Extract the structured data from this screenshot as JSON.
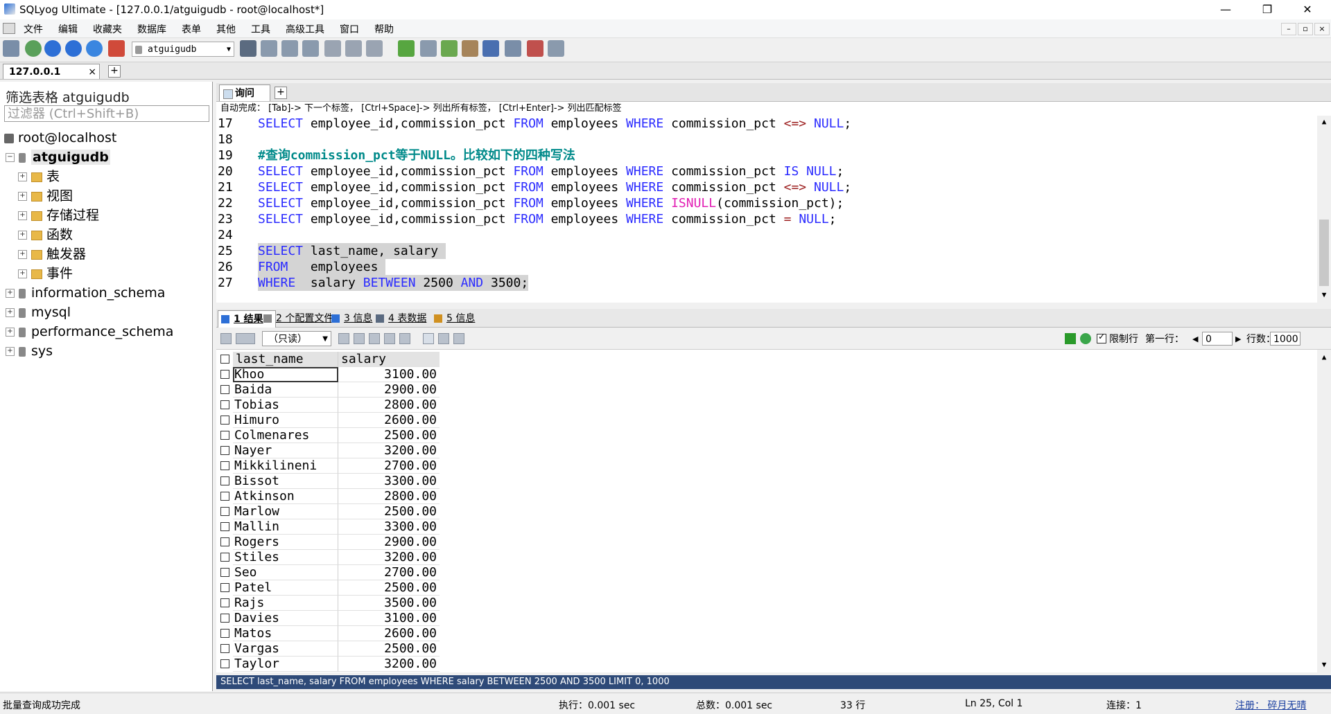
{
  "window": {
    "title": "SQLyog Ultimate - [127.0.0.1/atguigudb - root@localhost*]",
    "minimize": "—",
    "maximize": "❐",
    "close": "✕"
  },
  "menu": [
    "文件",
    "编辑",
    "收藏夹",
    "数据库",
    "表单",
    "其他",
    "工具",
    "高级工具",
    "窗口",
    "帮助"
  ],
  "toolbar": {
    "database_select": "atguigudb"
  },
  "connection_tab": {
    "label": "127.0.0.1",
    "close": "×"
  },
  "left_panel": {
    "filter_label": "筛选表格 atguigudb",
    "filter_placeholder": "过滤器 (Ctrl+Shift+B)",
    "server": "root@localhost",
    "current_db": "atguigudb",
    "current_db_children": [
      "表",
      "视图",
      "存储过程",
      "函数",
      "触发器",
      "事件"
    ],
    "other_dbs": [
      "information_schema",
      "mysql",
      "performance_schema",
      "sys"
    ]
  },
  "editor": {
    "tab_label": "询问",
    "autocomplete_hint": "自动完成： [Tab]-> 下一个标签， [Ctrl+Space]-> 列出所有标签， [Ctrl+Enter]-> 列出匹配标签",
    "lines": [
      {
        "n": "17",
        "parts": [
          [
            "kw",
            "SELECT"
          ],
          [
            "t",
            " employee_id,commission_pct "
          ],
          [
            "kw",
            "FROM"
          ],
          [
            "t",
            " employees "
          ],
          [
            "kw",
            "WHERE"
          ],
          [
            "t",
            " commission_pct "
          ],
          [
            "op",
            "<=>"
          ],
          [
            "t",
            " "
          ],
          [
            "kw",
            "NULL"
          ],
          [
            "t",
            ";"
          ]
        ]
      },
      {
        "n": "18",
        "parts": []
      },
      {
        "n": "19",
        "parts": [
          [
            "cm",
            "#查询commission_pct等于NULL。比较如下的四种写法"
          ]
        ]
      },
      {
        "n": "20",
        "parts": [
          [
            "kw",
            "SELECT"
          ],
          [
            "t",
            " employee_id,commission_pct "
          ],
          [
            "kw",
            "FROM"
          ],
          [
            "t",
            " employees "
          ],
          [
            "kw",
            "WHERE"
          ],
          [
            "t",
            " commission_pct "
          ],
          [
            "kw",
            "IS NULL"
          ],
          [
            "t",
            ";"
          ]
        ]
      },
      {
        "n": "21",
        "parts": [
          [
            "kw",
            "SELECT"
          ],
          [
            "t",
            " employee_id,commission_pct "
          ],
          [
            "kw",
            "FROM"
          ],
          [
            "t",
            " employees "
          ],
          [
            "kw",
            "WHERE"
          ],
          [
            "t",
            " commission_pct "
          ],
          [
            "op",
            "<=>"
          ],
          [
            "t",
            " "
          ],
          [
            "kw",
            "NULL"
          ],
          [
            "t",
            ";"
          ]
        ]
      },
      {
        "n": "22",
        "parts": [
          [
            "kw",
            "SELECT"
          ],
          [
            "t",
            " employee_id,commission_pct "
          ],
          [
            "kw",
            "FROM"
          ],
          [
            "t",
            " employees "
          ],
          [
            "kw",
            "WHERE"
          ],
          [
            "t",
            " "
          ],
          [
            "fn",
            "ISNULL"
          ],
          [
            "t",
            "(commission_pct);"
          ]
        ]
      },
      {
        "n": "23",
        "parts": [
          [
            "kw",
            "SELECT"
          ],
          [
            "t",
            " employee_id,commission_pct "
          ],
          [
            "kw",
            "FROM"
          ],
          [
            "t",
            " employees "
          ],
          [
            "kw",
            "WHERE"
          ],
          [
            "t",
            " commission_pct "
          ],
          [
            "op",
            "="
          ],
          [
            "t",
            " "
          ],
          [
            "kw",
            "NULL"
          ],
          [
            "t",
            ";"
          ]
        ]
      },
      {
        "n": "24",
        "parts": []
      },
      {
        "n": "25",
        "sel": true,
        "parts": [
          [
            "kw",
            "SELECT"
          ],
          [
            "t",
            " last_name, salary "
          ]
        ]
      },
      {
        "n": "26",
        "sel": true,
        "parts": [
          [
            "kw",
            "FROM"
          ],
          [
            "t",
            "   employees "
          ]
        ]
      },
      {
        "n": "27",
        "sel": true,
        "parts": [
          [
            "kw",
            "WHERE"
          ],
          [
            "t",
            "  salary "
          ],
          [
            "kw",
            "BETWEEN"
          ],
          [
            "t",
            " 2500 "
          ],
          [
            "kw",
            "AND"
          ],
          [
            "t",
            " 3500;"
          ]
        ]
      }
    ]
  },
  "result_tabs": [
    {
      "label": "1 结果",
      "active": true
    },
    {
      "label": "2 个配置文件",
      "active": false
    },
    {
      "label": "3 信息",
      "active": false
    },
    {
      "label": "4 表数据",
      "active": false
    },
    {
      "label": "5 信息",
      "active": false
    }
  ],
  "result_toolbar": {
    "mode_select": "（只读）",
    "limit_label": "限制行",
    "first_row_label": "第一行：",
    "first_row_value": "0",
    "rows_label": "行数：",
    "rows_value": "1000"
  },
  "grid": {
    "columns": [
      "last_name",
      "salary"
    ],
    "rows": [
      [
        "Khoo",
        "3100.00"
      ],
      [
        "Baida",
        "2900.00"
      ],
      [
        "Tobias",
        "2800.00"
      ],
      [
        "Himuro",
        "2600.00"
      ],
      [
        "Colmenares",
        "2500.00"
      ],
      [
        "Nayer",
        "3200.00"
      ],
      [
        "Mikkilineni",
        "2700.00"
      ],
      [
        "Bissot",
        "3300.00"
      ],
      [
        "Atkinson",
        "2800.00"
      ],
      [
        "Marlow",
        "2500.00"
      ],
      [
        "Mallin",
        "3300.00"
      ],
      [
        "Rogers",
        "2900.00"
      ],
      [
        "Stiles",
        "3200.00"
      ],
      [
        "Seo",
        "2700.00"
      ],
      [
        "Patel",
        "2500.00"
      ],
      [
        "Rajs",
        "3500.00"
      ],
      [
        "Davies",
        "3100.00"
      ],
      [
        "Matos",
        "2600.00"
      ],
      [
        "Vargas",
        "2500.00"
      ],
      [
        "Taylor",
        "3200.00"
      ]
    ],
    "status_sql": "SELECT last_name, salary FROM employees WHERE salary BETWEEN 2500 AND 3500 LIMIT 0, 1000"
  },
  "statusbar": {
    "message": "批量查询成功完成",
    "exec": "执行：0.001 sec",
    "total": "总数：0.001 sec",
    "rows": "33 行",
    "position": "Ln 25, Col 1",
    "connections": "连接：1",
    "register": "注册： 碎月无晴"
  }
}
